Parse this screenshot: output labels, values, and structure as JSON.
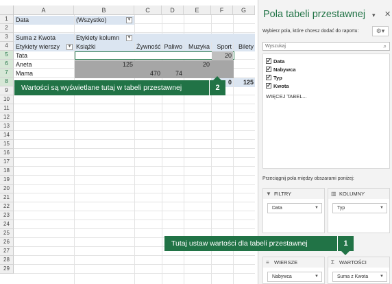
{
  "sheet": {
    "columns": [
      "A",
      "B",
      "C",
      "D",
      "E",
      "F",
      "G"
    ],
    "rows": [
      "1",
      "2",
      "3",
      "4",
      "5",
      "6",
      "7",
      "8",
      "9",
      "10",
      "11",
      "12",
      "13",
      "14",
      "15",
      "16",
      "17",
      "18",
      "19",
      "20",
      "21",
      "22",
      "23",
      "24",
      "25",
      "26",
      "27",
      "28",
      "29"
    ],
    "filter_label": "Data",
    "filter_value": "(Wszystko)",
    "values_label": "Suma z Kwota",
    "col_labels_header": "Etykiety kolumn",
    "row_labels_header": "Etykiety wierszy",
    "categories": [
      "Książki",
      "Żywność",
      "Paliwo",
      "Muzyka",
      "Sport",
      "Bilety"
    ],
    "row_names": [
      "Tata",
      "Aneta",
      "Mama"
    ],
    "row_values": {
      "tata_sport": "20",
      "aneta_ksiazki": "125",
      "aneta_muzyka": "20",
      "mama_zywnosc": "470",
      "mama_paliwo": "74"
    },
    "total_partial": {
      "sport": "0",
      "bilety": "125"
    }
  },
  "callouts": {
    "top_text": "Wartości są wyświetlane tutaj w tabeli przestawnej",
    "top_num": "2",
    "bottom_text": "Tutaj ustaw wartości dla tabeli przestawnej",
    "bottom_num": "1"
  },
  "pane": {
    "title": "Pola tabeli przestawnej",
    "subtitle": "Wybierz pola, które chcesz dodać do raportu:",
    "search_placeholder": "Wyszukaj",
    "fields": [
      "Data",
      "Nabywca",
      "Typ",
      "Kwota"
    ],
    "more_tables": "WIĘCEJ TABEL...",
    "areas_label": "Przeciągnij pola między obszarami poniżej:",
    "areas": {
      "filters": {
        "title": "FILTRY",
        "pill": "Data"
      },
      "columns": {
        "title": "KOLUMNY",
        "pill": "Typ"
      },
      "rows": {
        "title": "WIERSZE",
        "pill": "Nabywca"
      },
      "values": {
        "title": "WARTOŚCI",
        "pill": "Suma z Kwota"
      }
    }
  },
  "colors": {
    "accent": "#217346",
    "header_blue": "#dbe5f1",
    "data_grey": "#a6a6a6"
  }
}
